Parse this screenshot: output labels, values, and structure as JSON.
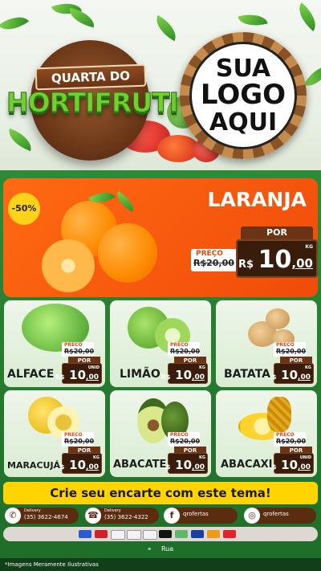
{
  "header": {
    "day_label": "QUARTA DO",
    "title": "HORTIFRUTI",
    "logo_lines": [
      "SUA",
      "LOGO",
      "AQUI"
    ]
  },
  "featured": {
    "discount": "-50%",
    "name": "LARANJA",
    "preco_label": "PREÇO",
    "por_label": "POR",
    "old_price": "R$20,00",
    "currency": "R$",
    "price_int": "10",
    "price_cents": ",00",
    "unit": "KG"
  },
  "products": [
    {
      "name": "ALFACE",
      "preco_label": "PRECO",
      "old_price": "R$20,00",
      "por_label": "POR",
      "currency": "R$",
      "price_int": "10",
      "price_cents": ",00",
      "unit": "UNID"
    },
    {
      "name": "LIMÃO",
      "preco_label": "PRECO",
      "old_price": "R$20,00",
      "por_label": "POR",
      "currency": "R$",
      "price_int": "10",
      "price_cents": ",00",
      "unit": "KG"
    },
    {
      "name": "BATATA",
      "preco_label": "PRECO",
      "old_price": "R$20,00",
      "por_label": "POR",
      "currency": "R$",
      "price_int": "10",
      "price_cents": ",00",
      "unit": "KG"
    },
    {
      "name": "MARACUJÁ",
      "preco_label": "PRECO",
      "old_price": "R$20,00",
      "por_label": "POR",
      "currency": "R$",
      "price_int": "10",
      "price_cents": ",00",
      "unit": "KG"
    },
    {
      "name": "ABACATE",
      "preco_label": "PRECO",
      "old_price": "R$20,00",
      "por_label": "POR",
      "currency": "R$",
      "price_int": "10",
      "price_cents": ",00",
      "unit": "KG"
    },
    {
      "name": "ABACAXI",
      "preco_label": "PRECO",
      "old_price": "R$20,00",
      "por_label": "POR",
      "currency": "R$",
      "price_int": "10",
      "price_cents": ",00",
      "unit": "UNID"
    }
  ],
  "cta": "Crie seu encarte com este tema!",
  "contacts": {
    "whatsapp_label": "Delivery",
    "whatsapp_value": "(35) 3622-4674",
    "phone_label": "Delivery",
    "phone_value": "(35) 3622-4322",
    "facebook": "qrofertas",
    "instagram": "qrofertas"
  },
  "address": "Rua",
  "footer_note": "*Imagens Meramente Ilustrativas",
  "colors": {
    "green_dark": "#1f6b2b",
    "orange": "#ff6a12",
    "yellow": "#ffd400",
    "brown": "#5a2c10"
  },
  "icons": {
    "whatsapp": "whatsapp-icon",
    "phone": "phone-icon",
    "facebook": "facebook-icon",
    "instagram": "instagram-icon",
    "location": "location-pin-icon"
  }
}
